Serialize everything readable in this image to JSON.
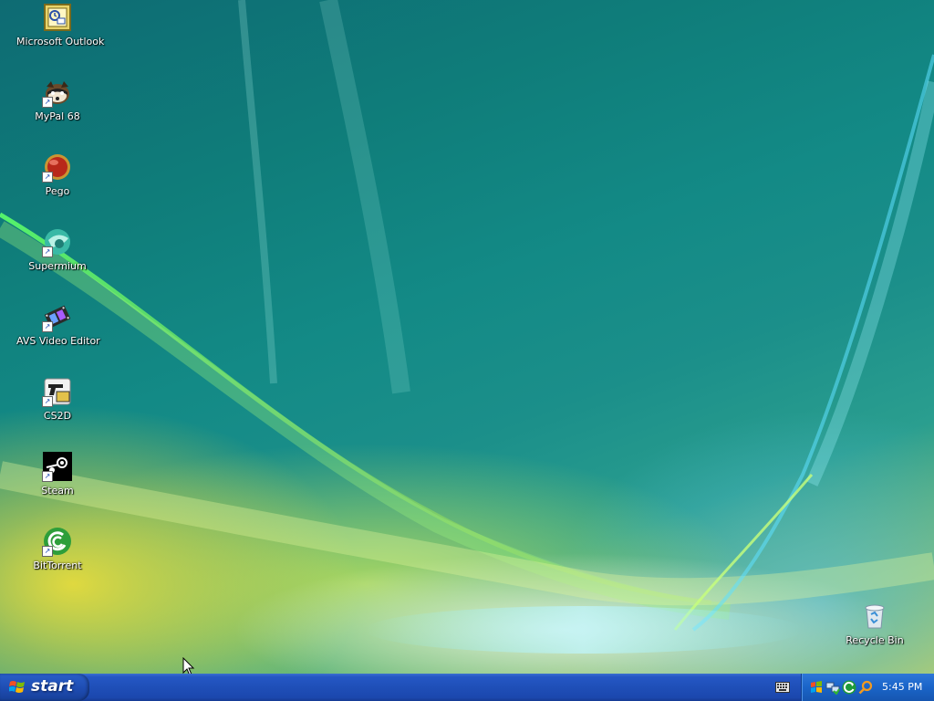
{
  "desktop": {
    "icons": [
      {
        "label": "Microsoft Outlook",
        "icon": "outlook-icon",
        "shortcut": false
      },
      {
        "label": "MyPal 68",
        "icon": "mypal-icon",
        "shortcut": true
      },
      {
        "label": "Pego",
        "icon": "pego-icon",
        "shortcut": true
      },
      {
        "label": "Supermium",
        "icon": "supermium-icon",
        "shortcut": true
      },
      {
        "label": "AVS Video Editor",
        "icon": "film-icon",
        "shortcut": true
      },
      {
        "label": "CS2D",
        "icon": "cs2d-icon",
        "shortcut": true
      },
      {
        "label": "Steam",
        "icon": "steam-icon",
        "shortcut": true
      },
      {
        "label": "BitTorrent",
        "icon": "bittorrent-icon",
        "shortcut": true
      }
    ],
    "recycle_bin": {
      "label": "Recycle Bin",
      "icon": "recycle-bin-icon"
    }
  },
  "taskbar": {
    "start_label": "start",
    "tray_icons": [
      "windows-flag-icon",
      "network-icon",
      "update-icon",
      "search-icon"
    ],
    "clock": "5:45 PM",
    "colors": {
      "taskbar": "#1f4fb8",
      "tray": "#1a64c8",
      "start": "#1f4eb4"
    }
  }
}
